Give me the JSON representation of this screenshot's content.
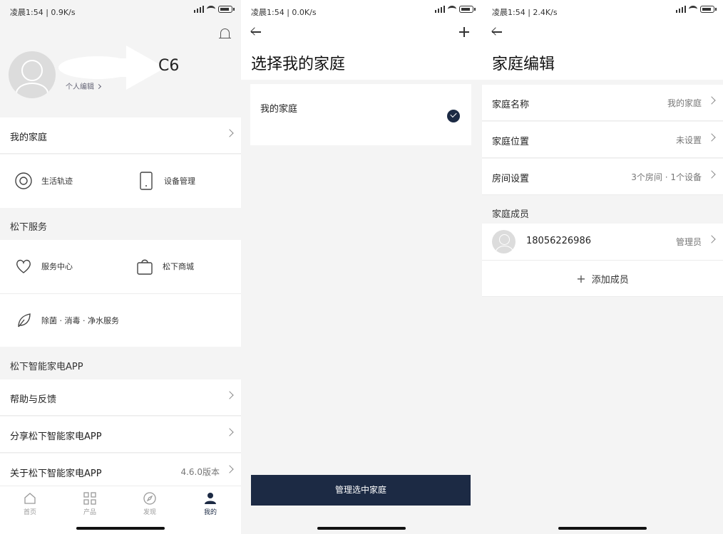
{
  "screens": [
    {
      "status": {
        "left": "凌晨1:54 | 0.9K/s"
      },
      "profile": {
        "nickname_tail": "C6",
        "edit_label": "个人编辑"
      },
      "my_home": {
        "label": "我的家庭"
      },
      "home_grid": [
        {
          "label": "生活轨迹",
          "icon": "life-track-icon"
        },
        {
          "label": "设备管理",
          "icon": "device-icon"
        }
      ],
      "services_title": "松下服务",
      "services": [
        {
          "label": "服务中心",
          "icon": "service-heart-icon"
        },
        {
          "label": "松下商城",
          "icon": "shopping-bag-icon"
        },
        {
          "label": "除菌 · 消毒 · 净水服务",
          "icon": "leaf-icon"
        }
      ],
      "app_title": "松下智能家电APP",
      "app_rows": [
        {
          "label": "帮助与反馈",
          "value": ""
        },
        {
          "label": "分享松下智能家电APP",
          "value": ""
        },
        {
          "label": "关于松下智能家电APP",
          "value": "4.6.0版本"
        }
      ],
      "tabs": [
        {
          "label": "首页",
          "icon": "home-icon"
        },
        {
          "label": "产品",
          "icon": "apps-icon"
        },
        {
          "label": "发现",
          "icon": "compass-icon"
        },
        {
          "label": "我的",
          "icon": "person-icon",
          "active": true
        }
      ]
    },
    {
      "status": {
        "left": "凌晨1:54 | 0.0K/s"
      },
      "title": "选择我的家庭",
      "homes": [
        {
          "label": "我的家庭",
          "selected": true
        }
      ],
      "manage_button": "管理选中家庭"
    },
    {
      "status": {
        "left": "凌晨1:54 | 2.4K/s"
      },
      "title": "家庭编辑",
      "rows": [
        {
          "label": "家庭名称",
          "value": "我的家庭"
        },
        {
          "label": "家庭位置",
          "value": "未设置"
        },
        {
          "label": "房间设置",
          "value": "3个房间 · 1个设备"
        }
      ],
      "members_title": "家庭成员",
      "members": [
        {
          "phone": "18056226986",
          "role": "管理员"
        }
      ],
      "add_member": "添加成员"
    }
  ],
  "colors": {
    "accent": "#1c2a44",
    "background": "#f4f4f4",
    "card": "#ffffff"
  }
}
